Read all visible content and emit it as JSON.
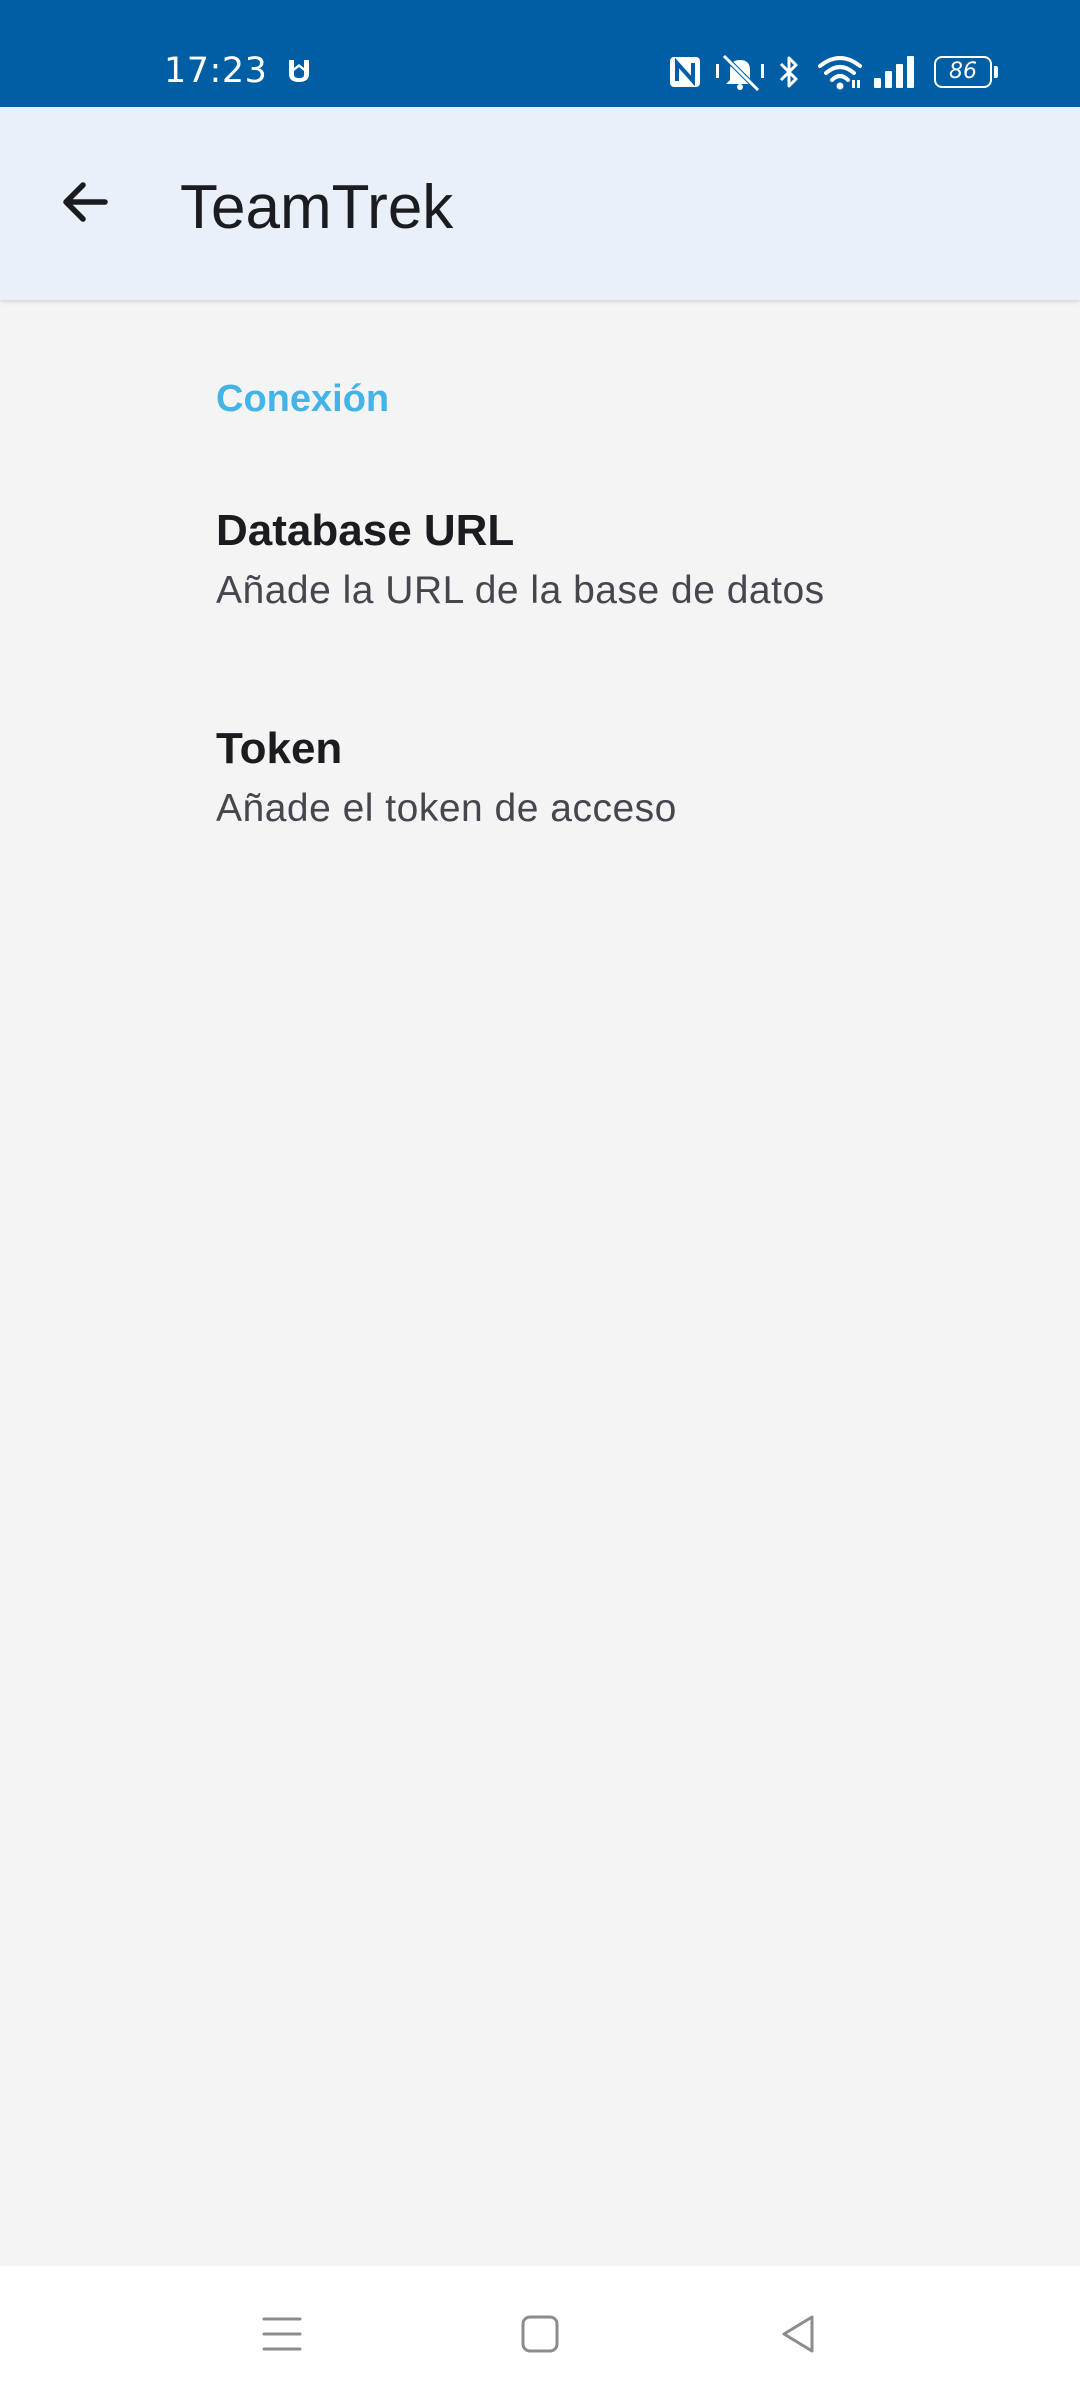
{
  "status_bar": {
    "time": "17:23",
    "battery_level": "86",
    "icons": [
      "app-notification-icon",
      "nfc-icon",
      "vibrate-mute-icon",
      "bluetooth-icon",
      "wifi-icon",
      "signal-icon",
      "battery-icon"
    ],
    "background_color": "#005fa4"
  },
  "app_bar": {
    "title": "TeamTrek",
    "back_icon": "arrow-back-icon",
    "background_color": "#e9f0f9"
  },
  "settings": {
    "section_header": "Conexión",
    "accent_color": "#42b4e8",
    "items": [
      {
        "title": "Database URL",
        "summary": "Añade la URL de la base de datos"
      },
      {
        "title": "Token",
        "summary": "Añade el token de acceso"
      }
    ]
  },
  "nav_bar": {
    "buttons": [
      "recents-icon",
      "home-icon",
      "back-triangle-icon"
    ]
  }
}
